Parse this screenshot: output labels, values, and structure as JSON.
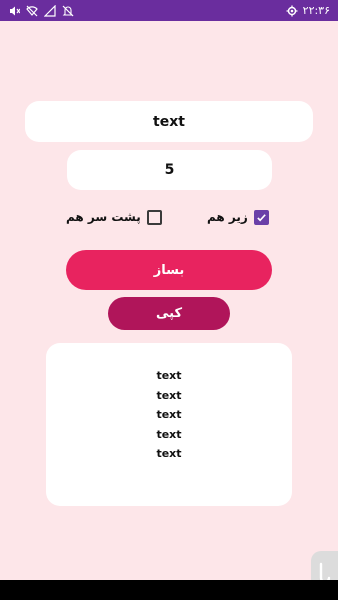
{
  "status_bar": {
    "time": "۲۲:۳۶",
    "icons_left": [
      "mute-icon",
      "no-wifi-icon",
      "data-off-icon",
      "notification-off-icon"
    ],
    "icons_right": [
      "gear-icon"
    ]
  },
  "text_input": {
    "value": "text"
  },
  "count_input": {
    "value": "5"
  },
  "options": [
    {
      "label": "زیر هم",
      "checked": true
    },
    {
      "label": "پشت سر هم",
      "checked": false
    }
  ],
  "build_button": {
    "label": "بساز"
  },
  "copy_button": {
    "label": "کپی"
  },
  "output": {
    "lines": [
      "text",
      "text",
      "text",
      "text",
      "text"
    ]
  },
  "colors": {
    "background": "#fde6e9",
    "status_bar": "#6a2d9e",
    "primary_button": "#e8235f",
    "secondary_button": "#b0155a",
    "checkbox": "#6a3fa8"
  }
}
